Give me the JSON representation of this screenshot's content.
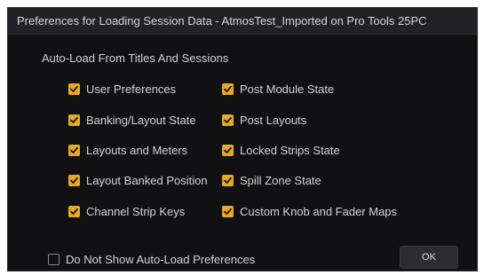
{
  "dialog": {
    "title": "Preferences for Loading Session Data - AtmosTest_Imported on Pro Tools 25PC",
    "section_header": "Auto-Load From Titles And Sessions",
    "left_options": [
      {
        "label": "User Preferences",
        "checked": true
      },
      {
        "label": "Banking/Layout State",
        "checked": true
      },
      {
        "label": "Layouts and Meters",
        "checked": true
      },
      {
        "label": "Layout Banked Position",
        "checked": true
      },
      {
        "label": "Channel Strip Keys",
        "checked": true
      }
    ],
    "right_options": [
      {
        "label": "Post Module State",
        "checked": true
      },
      {
        "label": "Post Layouts",
        "checked": true
      },
      {
        "label": "Locked Strips State",
        "checked": true
      },
      {
        "label": "Spill Zone State",
        "checked": true
      },
      {
        "label": "Custom Knob and Fader Maps",
        "checked": true
      }
    ],
    "do_not_show": {
      "label": "Do Not Show Auto-Load Preferences",
      "checked": false
    },
    "ok_label": "OK"
  },
  "colors": {
    "dialog_bg": "#111113",
    "title_bar_bg": "#222226",
    "checkbox_accent": "#e8a81f",
    "text": "#d4d4d7"
  }
}
